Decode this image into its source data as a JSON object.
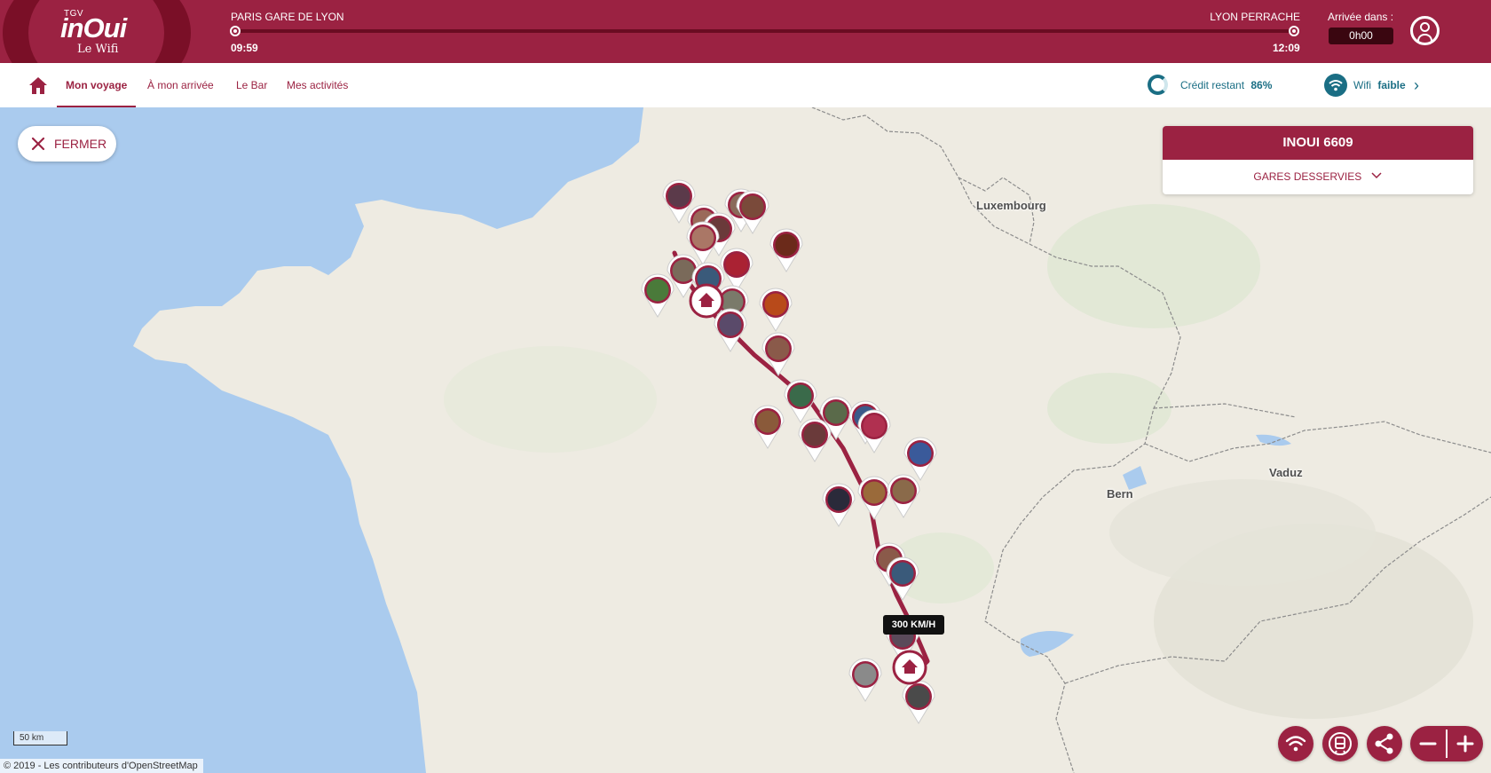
{
  "logo": {
    "brand_small": "TGV",
    "brand": "inOui",
    "subtitle": "Le Wifi"
  },
  "trip": {
    "departure_station": "PARIS GARE DE LYON",
    "arrival_station": "LYON PERRACHE",
    "departure_time": "09:59",
    "arrival_time": "12:09",
    "arrival_in_label": "Arrivée dans :",
    "arrival_in_value": "0h00"
  },
  "nav": {
    "items": [
      {
        "label": "Mon voyage",
        "active": true
      },
      {
        "label": "À mon arrivée",
        "active": false
      },
      {
        "label": "Le Bar",
        "active": false
      },
      {
        "label": "Mes activités",
        "active": false
      }
    ],
    "credit_label": "Crédit restant",
    "credit_value": "86%",
    "wifi_label": "Wifi",
    "wifi_value": "faible"
  },
  "map": {
    "close_label": "FERMER",
    "train_name": "INOUI 6609",
    "stations_label": "GARES DESSERVIES",
    "cities": [
      "Luxembourg",
      "Bern",
      "Vaduz"
    ],
    "speed_label": "300 KM/H",
    "scale_label": "50 km",
    "attribution": "© 2019 - Les contributeurs d'OpenStreetMap"
  },
  "controls": [
    "wifi-button",
    "train-button",
    "share-button",
    "zoom-out-button",
    "zoom-in-button"
  ],
  "colors": {
    "brand": "#9b2242",
    "brand_dark": "#7a0f27",
    "teal": "#1a6e84",
    "sea": "#aacbee",
    "land": "#eeebe2"
  }
}
